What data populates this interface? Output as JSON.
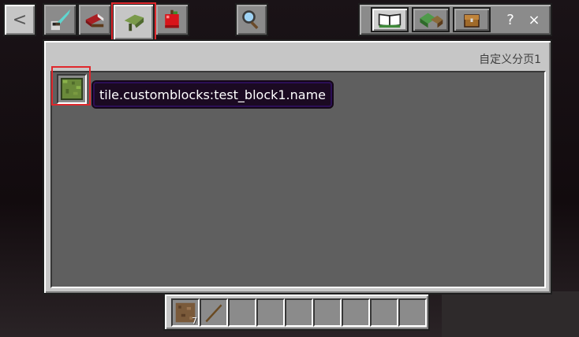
{
  "top_bar": {
    "back_label": "<",
    "category_tabs": [
      {
        "name": "combat",
        "icon": "sword-helmet-icon"
      },
      {
        "name": "furniture",
        "icon": "bed-icon"
      },
      {
        "name": "custom",
        "icon": "leaf-tab-icon",
        "active": true
      },
      {
        "name": "food",
        "icon": "apple-icon"
      }
    ],
    "search_icon": "magnifier-icon",
    "right_tabs": [
      {
        "name": "recipe-book",
        "icon": "book-icon"
      },
      {
        "name": "crafting",
        "icon": "cube-stack-icon"
      },
      {
        "name": "inventory",
        "icon": "chest-icon"
      }
    ],
    "help_label": "?",
    "close_label": "×"
  },
  "panel": {
    "title": "自定义分页1",
    "items": [
      {
        "name": "test_block1",
        "icon": "grass-block-icon"
      }
    ]
  },
  "tooltip": {
    "text": "tile.customblocks:test_block1.name"
  },
  "hotbar": {
    "slots": [
      {
        "item": "dirt-block-icon",
        "count": "7"
      },
      {
        "item": "stick-icon",
        "count": ""
      },
      {
        "item": "",
        "count": ""
      },
      {
        "item": "",
        "count": ""
      },
      {
        "item": "",
        "count": ""
      },
      {
        "item": "",
        "count": ""
      },
      {
        "item": "",
        "count": ""
      },
      {
        "item": "",
        "count": ""
      },
      {
        "item": "",
        "count": ""
      }
    ]
  },
  "colors": {
    "highlight": "#e0282d",
    "panel_bg": "#c6c6c6",
    "grid_bg": "#5f5f5f",
    "tooltip_bg": "#1b0a22",
    "tooltip_border": "#2b0f55"
  }
}
